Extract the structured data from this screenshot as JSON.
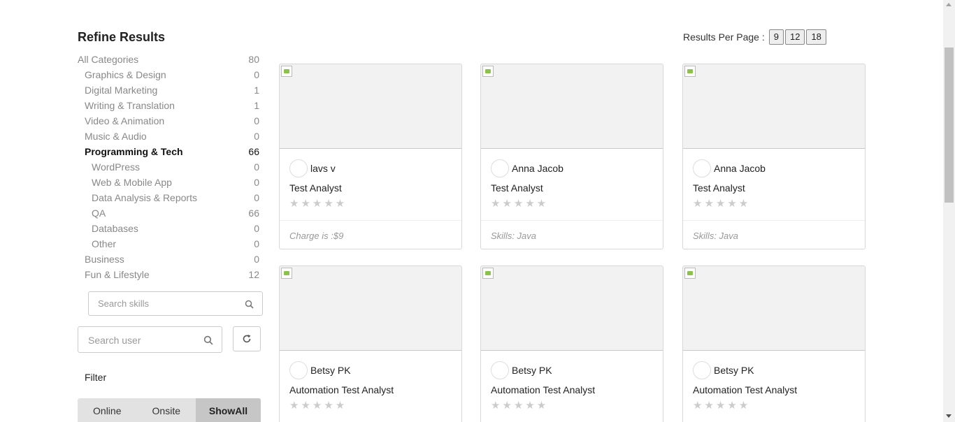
{
  "sidebar": {
    "title": "Refine Results",
    "categories": [
      {
        "label": "All Categories",
        "count": "80",
        "level": 0,
        "active": false
      },
      {
        "label": "Graphics & Design",
        "count": "0",
        "level": 1,
        "active": false
      },
      {
        "label": "Digital Marketing",
        "count": "1",
        "level": 1,
        "active": false
      },
      {
        "label": "Writing & Translation",
        "count": "1",
        "level": 1,
        "active": false
      },
      {
        "label": "Video & Animation",
        "count": "0",
        "level": 1,
        "active": false
      },
      {
        "label": "Music & Audio",
        "count": "0",
        "level": 1,
        "active": false
      },
      {
        "label": "Programming & Tech",
        "count": "66",
        "level": 1,
        "active": true
      },
      {
        "label": "WordPress",
        "count": "0",
        "level": 2,
        "active": false
      },
      {
        "label": "Web & Mobile App",
        "count": "0",
        "level": 2,
        "active": false
      },
      {
        "label": "Data Analysis & Reports",
        "count": "0",
        "level": 2,
        "active": false
      },
      {
        "label": "QA",
        "count": "66",
        "level": 2,
        "active": false
      },
      {
        "label": "Databases",
        "count": "0",
        "level": 2,
        "active": false
      },
      {
        "label": "Other",
        "count": "0",
        "level": 2,
        "active": false
      },
      {
        "label": "Business",
        "count": "0",
        "level": 1,
        "active": false
      },
      {
        "label": "Fun & Lifestyle",
        "count": "12",
        "level": 1,
        "active": false
      }
    ],
    "skills_search_placeholder": "Search skills",
    "user_search_placeholder": "Search user",
    "filter_label": "Filter",
    "filter_options": [
      "Online",
      "Onsite",
      "ShowAll"
    ],
    "filter_selected": "ShowAll"
  },
  "results_per_page": {
    "label": "Results Per Page :",
    "options": [
      "9",
      "12",
      "18"
    ]
  },
  "cards": [
    {
      "author": "lavs v",
      "title": "Test Analyst",
      "stars": "★★★★★",
      "footer": "Charge is :$9"
    },
    {
      "author": "Anna Jacob",
      "title": "Test Analyst",
      "stars": "★★★★★",
      "footer": "Skills: Java"
    },
    {
      "author": "Anna Jacob",
      "title": "Test Analyst",
      "stars": "★★★★★",
      "footer": "Skills: Java"
    },
    {
      "author": "Betsy PK",
      "title": "Automation Test Analyst",
      "stars": "★★★★★",
      "footer": ""
    },
    {
      "author": "Betsy PK",
      "title": "Automation Test Analyst",
      "stars": "★★★★★",
      "footer": ""
    },
    {
      "author": "Betsy PK",
      "title": "Automation Test Analyst",
      "stars": "★★★★★",
      "footer": ""
    }
  ],
  "icons": {
    "search": "search-icon",
    "refresh": "refresh-icon",
    "broken_image": "broken-image-icon",
    "star": "star-icon"
  }
}
